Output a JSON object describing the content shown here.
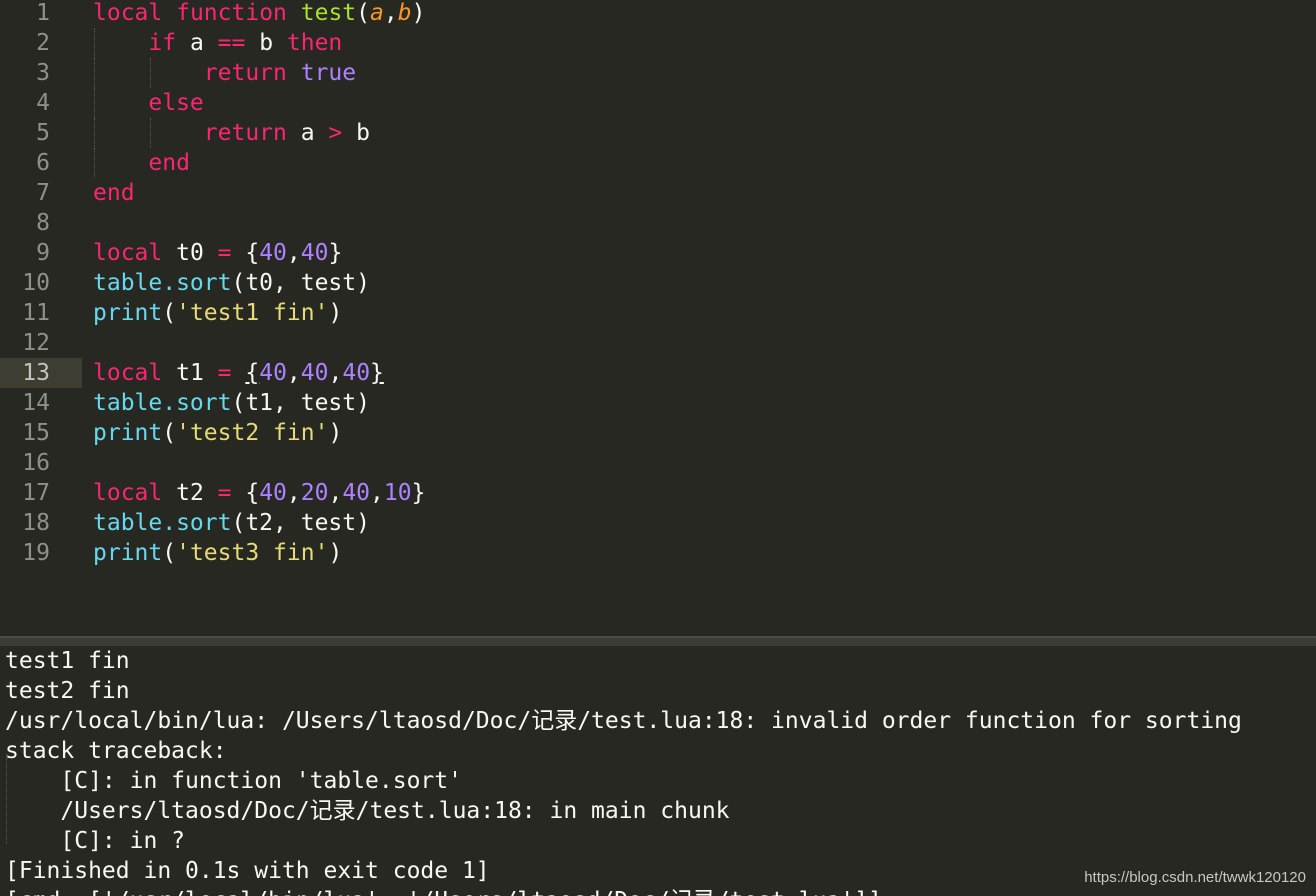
{
  "editor": {
    "active_line": 13,
    "lines": [
      {
        "n": "1",
        "tokens": [
          [
            "kw",
            "local"
          ],
          [
            "p",
            " "
          ],
          [
            "kw",
            "function"
          ],
          [
            "p",
            " "
          ],
          [
            "fn",
            "test"
          ],
          [
            "p",
            "("
          ],
          [
            "param",
            "a"
          ],
          [
            "p",
            ","
          ],
          [
            "param",
            "b"
          ],
          [
            "p",
            ")"
          ]
        ]
      },
      {
        "n": "2",
        "tokens": [
          [
            "p",
            "    "
          ],
          [
            "kw",
            "if"
          ],
          [
            "p",
            " a "
          ],
          [
            "op",
            "=="
          ],
          [
            "p",
            " b "
          ],
          [
            "kw",
            "then"
          ]
        ]
      },
      {
        "n": "3",
        "tokens": [
          [
            "p",
            "        "
          ],
          [
            "kw",
            "return"
          ],
          [
            "p",
            " "
          ],
          [
            "const",
            "true"
          ]
        ]
      },
      {
        "n": "4",
        "tokens": [
          [
            "p",
            "    "
          ],
          [
            "kw",
            "else"
          ]
        ]
      },
      {
        "n": "5",
        "tokens": [
          [
            "p",
            "        "
          ],
          [
            "kw",
            "return"
          ],
          [
            "p",
            " a "
          ],
          [
            "op",
            ">"
          ],
          [
            "p",
            " b"
          ]
        ]
      },
      {
        "n": "6",
        "tokens": [
          [
            "p",
            "    "
          ],
          [
            "kw",
            "end"
          ]
        ]
      },
      {
        "n": "7",
        "tokens": [
          [
            "kw",
            "end"
          ]
        ]
      },
      {
        "n": "8",
        "tokens": []
      },
      {
        "n": "9",
        "tokens": [
          [
            "kw",
            "local"
          ],
          [
            "p",
            " t0 "
          ],
          [
            "op",
            "="
          ],
          [
            "p",
            " {"
          ],
          [
            "num-lit",
            "40"
          ],
          [
            "p",
            ","
          ],
          [
            "num-lit",
            "40"
          ],
          [
            "p",
            "}"
          ]
        ]
      },
      {
        "n": "10",
        "tokens": [
          [
            "sup",
            "table.sort"
          ],
          [
            "p",
            "(t0, test)"
          ]
        ]
      },
      {
        "n": "11",
        "tokens": [
          [
            "sup",
            "print"
          ],
          [
            "p",
            "("
          ],
          [
            "str",
            "'test1 fin'"
          ],
          [
            "p",
            ")"
          ]
        ]
      },
      {
        "n": "12",
        "tokens": []
      },
      {
        "n": "13",
        "tokens": [
          [
            "kw",
            "local"
          ],
          [
            "p",
            " t1 "
          ],
          [
            "op",
            "="
          ],
          [
            "p",
            " "
          ],
          [
            "u",
            "{"
          ],
          [
            "num-lit",
            "40"
          ],
          [
            "p",
            ","
          ],
          [
            "num-lit",
            "40"
          ],
          [
            "p",
            ","
          ],
          [
            "num-lit",
            "40"
          ],
          [
            "u",
            "}"
          ]
        ]
      },
      {
        "n": "14",
        "tokens": [
          [
            "sup",
            "table.sort"
          ],
          [
            "p",
            "(t1, test)"
          ]
        ]
      },
      {
        "n": "15",
        "tokens": [
          [
            "sup",
            "print"
          ],
          [
            "p",
            "("
          ],
          [
            "str",
            "'test2 fin'"
          ],
          [
            "p",
            ")"
          ]
        ]
      },
      {
        "n": "16",
        "tokens": []
      },
      {
        "n": "17",
        "tokens": [
          [
            "kw",
            "local"
          ],
          [
            "p",
            " t2 "
          ],
          [
            "op",
            "="
          ],
          [
            "p",
            " {"
          ],
          [
            "num-lit",
            "40"
          ],
          [
            "p",
            ","
          ],
          [
            "num-lit",
            "20"
          ],
          [
            "p",
            ","
          ],
          [
            "num-lit",
            "40"
          ],
          [
            "p",
            ","
          ],
          [
            "num-lit",
            "10"
          ],
          [
            "p",
            "}"
          ]
        ]
      },
      {
        "n": "18",
        "tokens": [
          [
            "sup",
            "table.sort"
          ],
          [
            "p",
            "(t2, test)"
          ]
        ]
      },
      {
        "n": "19",
        "tokens": [
          [
            "sup",
            "print"
          ],
          [
            "p",
            "("
          ],
          [
            "str",
            "'test3 fin'"
          ],
          [
            "p",
            ")"
          ]
        ]
      }
    ]
  },
  "console": {
    "lines": [
      "test1 fin",
      "test2 fin",
      "/usr/local/bin/lua: /Users/ltaosd/Doc/记录/test.lua:18: invalid order function for sorting",
      "stack traceback:",
      "    [C]: in function 'table.sort'",
      "    /Users/ltaosd/Doc/记录/test.lua:18: in main chunk",
      "    [C]: in ?",
      "[Finished in 0.1s with exit code 1]",
      "[cmd: ['/usr/local/bin/lua', '/Users/ltaosd/Doc/记录/test.lua']]"
    ]
  },
  "watermark": "https://blog.csdn.net/twwk120120",
  "colors": {
    "background": "#272822",
    "keyword": "#f92672",
    "function": "#a6e22e",
    "parameter": "#fd971f",
    "number": "#ae81ff",
    "support": "#66d9ef",
    "string": "#e6db74",
    "text": "#f8f8f2"
  }
}
